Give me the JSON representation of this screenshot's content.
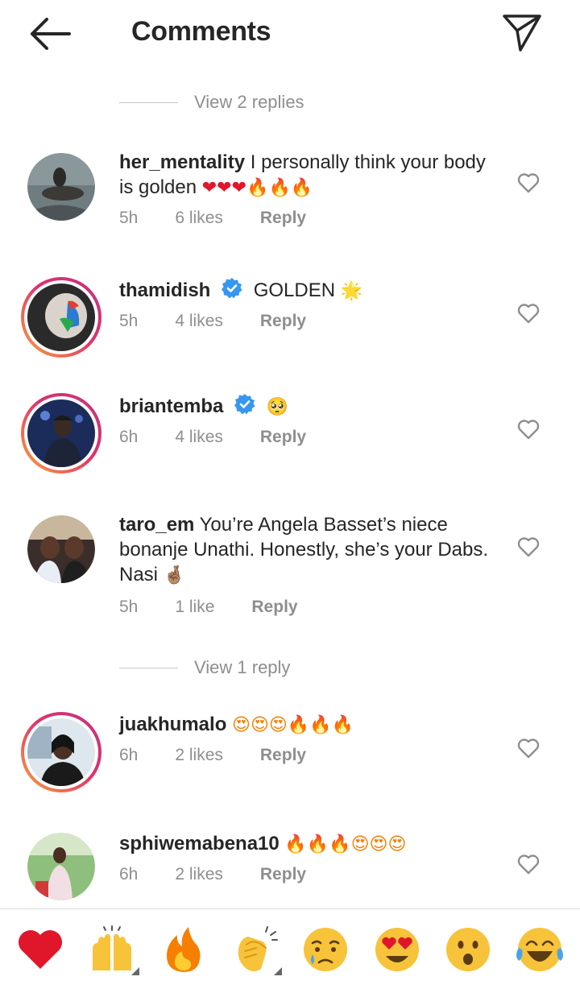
{
  "header": {
    "title": "Comments"
  },
  "view_replies_1": "View 2 replies",
  "view_replies_2": "View 1 reply",
  "comments": [
    {
      "user": "her_mentality",
      "text": "I personally think your body is golden",
      "emojis": "❤❤❤🔥🔥🔥",
      "time": "5h",
      "likes": "6 likes",
      "reply": "Reply",
      "verified": false
    },
    {
      "user": "thamidish",
      "text": "GOLDEN",
      "emojis": "🌟",
      "time": "5h",
      "likes": "4 likes",
      "reply": "Reply",
      "verified": true
    },
    {
      "user": "briantemba",
      "text": "",
      "emojis": "🥺",
      "time": "6h",
      "likes": "4 likes",
      "reply": "Reply",
      "verified": true
    },
    {
      "user": "taro_em",
      "text": "You’re Angela Basset’s niece bonanje Unathi. Honestly, she’s your Dabs. Nasi",
      "emojis": "🤞🏽",
      "time": "5h",
      "likes": "1 like",
      "reply": "Reply",
      "verified": false
    },
    {
      "user": "juakhumalo",
      "text": "",
      "emojis": "😍😍😍🔥🔥🔥",
      "time": "6h",
      "likes": "2 likes",
      "reply": "Reply",
      "verified": false
    },
    {
      "user": "sphiwemabena10",
      "text": "",
      "emojis": "🔥🔥🔥😍😍😍",
      "time": "6h",
      "likes": "2 likes",
      "reply": "Reply",
      "verified": false
    }
  ],
  "emoji_bar": [
    "heart",
    "raising-hands",
    "fire",
    "clapping-hands",
    "crying",
    "heart-eyes",
    "surprised",
    "tears-of-joy"
  ],
  "colors": {
    "heart": "#e0162b",
    "fire": "#f77f00",
    "emoji_yellow": "#f7c33a",
    "verified": "#3797f0",
    "muted": "#8e8e8e"
  }
}
